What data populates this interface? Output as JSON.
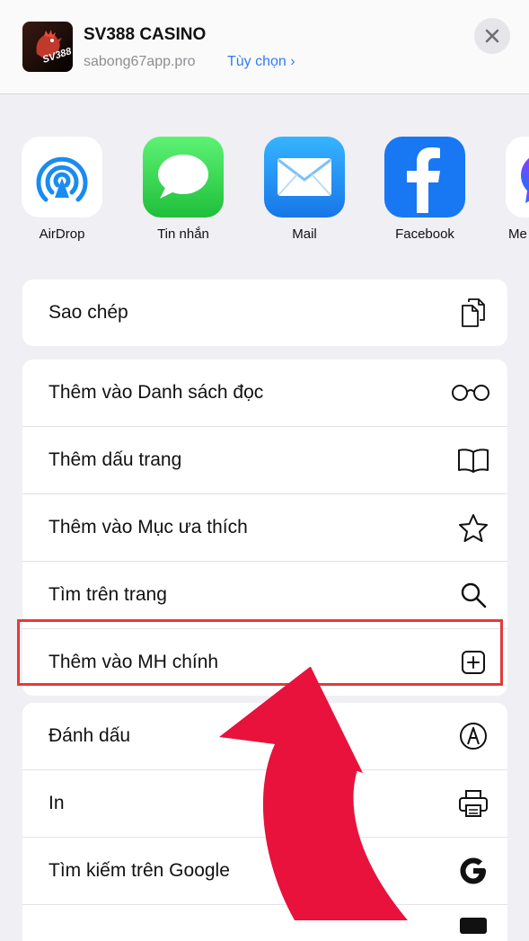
{
  "header": {
    "title": "SV388 CASINO",
    "url": "sabong67app.pro",
    "options_label": "Tùy chọn ›",
    "app_logo_text": "SV388"
  },
  "share_apps": [
    {
      "label": "AirDrop",
      "icon": "airdrop-icon"
    },
    {
      "label": "Tin nhắn",
      "icon": "messages-icon"
    },
    {
      "label": "Mail",
      "icon": "mail-icon"
    },
    {
      "label": "Facebook",
      "icon": "facebook-icon"
    },
    {
      "label": "Me",
      "icon": "messenger-icon"
    }
  ],
  "actions": {
    "copy": {
      "label": "Sao chép",
      "icon": "copy-icon"
    },
    "reading_list": {
      "label": "Thêm vào Danh sách đọc",
      "icon": "glasses-icon"
    },
    "bookmark": {
      "label": "Thêm dấu trang",
      "icon": "book-icon"
    },
    "favorites": {
      "label": "Thêm vào Mục ưa thích",
      "icon": "star-icon"
    },
    "find": {
      "label": "Tìm trên trang",
      "icon": "search-icon"
    },
    "home_screen": {
      "label": "Thêm vào MH chính",
      "icon": "plus-square-icon"
    },
    "markup": {
      "label": "Đánh dấu",
      "icon": "markup-icon"
    },
    "print": {
      "label": "In",
      "icon": "printer-icon"
    },
    "google": {
      "label": "Tìm kiếm trên Google",
      "icon": "google-icon"
    }
  },
  "colors": {
    "accent_link": "#2f7cf6",
    "highlight": "#e43a3a",
    "arrow": "#e8123c"
  }
}
